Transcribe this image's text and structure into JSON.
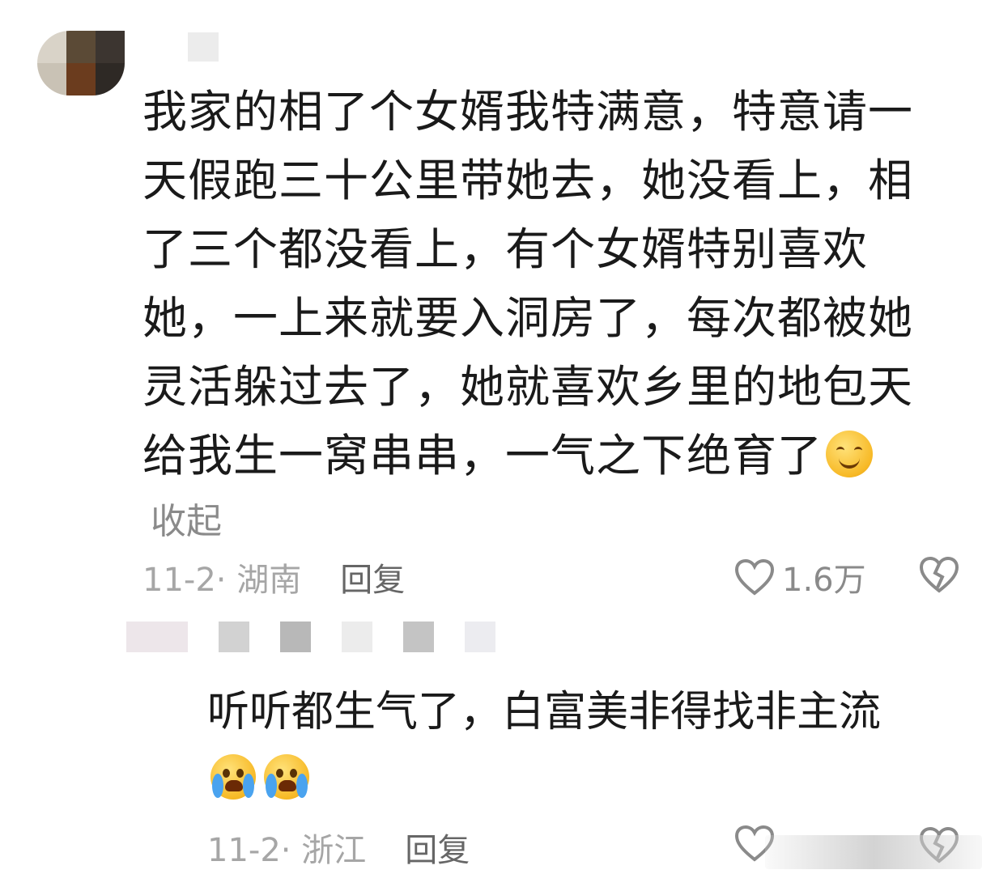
{
  "comment": {
    "lines": [
      "我家的相了个女婿我特满意，特意请一",
      "天假跑三十公里带她去，她没看上，相",
      "了三个都没看上，有个女婿特别喜欢",
      "她，一上来就要入洞房了，每次都被她",
      "灵活躲过去了，她就喜欢乡里的地包天",
      "给我生一窝串串，一气之下绝育了"
    ],
    "emoji": "smile-emoji",
    "collapse_label": "收起",
    "date_location": "11-2· 湖南",
    "reply_label": "回复",
    "like_count": "1.6万"
  },
  "reply": {
    "text": "听听都生气了，白富美非得找非主流",
    "emojis": [
      "crying-laughing-emoji",
      "crying-laughing-emoji"
    ],
    "date_location": "11-2· 浙江",
    "reply_label": "回复"
  }
}
